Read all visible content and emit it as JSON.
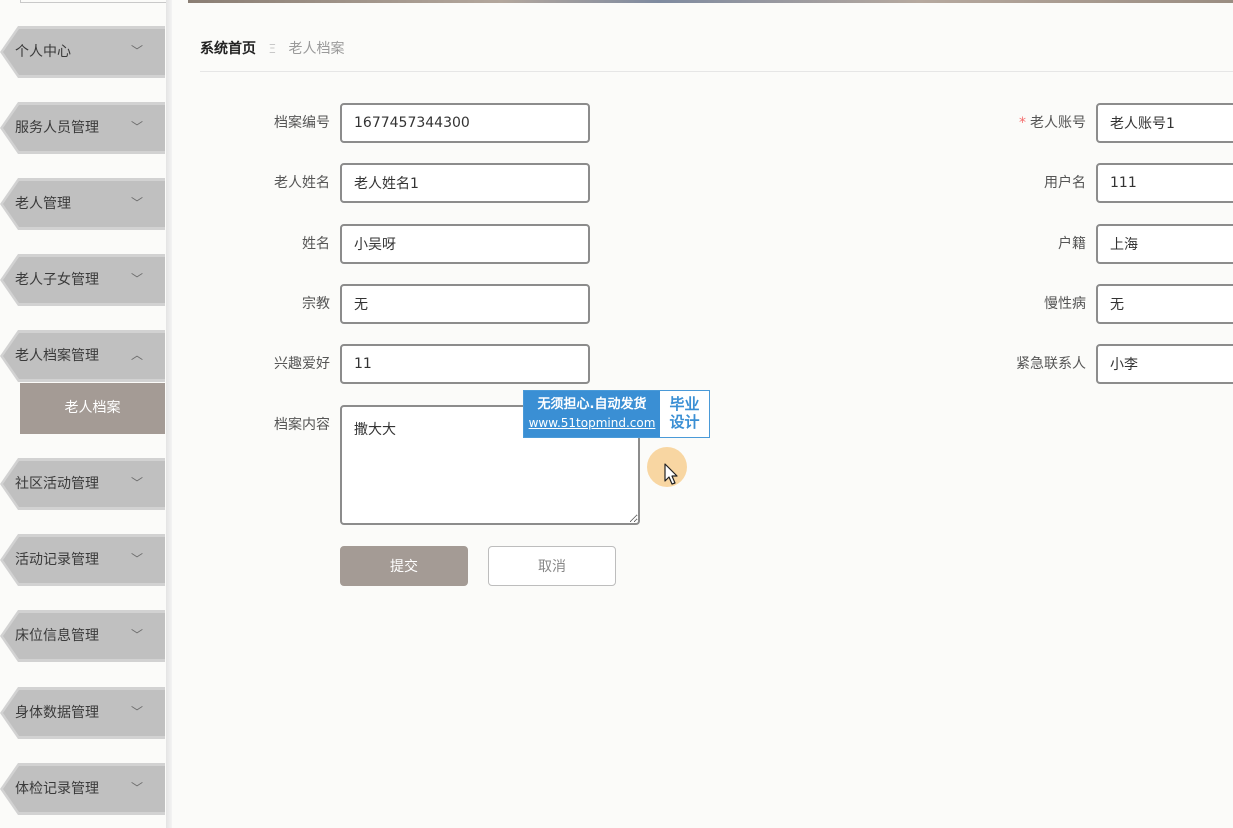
{
  "sidebar": {
    "items": [
      {
        "label": "个人中心",
        "expanded": false
      },
      {
        "label": "服务人员管理",
        "expanded": false
      },
      {
        "label": "老人管理",
        "expanded": false
      },
      {
        "label": "老人子女管理",
        "expanded": false
      },
      {
        "label": "老人档案管理",
        "expanded": true
      },
      {
        "label": "社区活动管理",
        "expanded": false
      },
      {
        "label": "活动记录管理",
        "expanded": false
      },
      {
        "label": "床位信息管理",
        "expanded": false
      },
      {
        "label": "身体数据管理",
        "expanded": false
      },
      {
        "label": "体检记录管理",
        "expanded": false
      }
    ],
    "sub_item": "老人档案",
    "chevron_down": "﹀",
    "chevron_up": "︿"
  },
  "breadcrumb": {
    "home": "系统首页",
    "separator": "Ξ",
    "current": "老人档案"
  },
  "form": {
    "archive_no": {
      "label": "档案编号",
      "value": "1677457344300"
    },
    "elder_account": {
      "label": "老人账号",
      "value": "老人账号1",
      "required_mark": "*"
    },
    "elder_name": {
      "label": "老人姓名",
      "value": "老人姓名1"
    },
    "username": {
      "label": "用户名",
      "value": "111"
    },
    "name": {
      "label": "姓名",
      "value": "小吴呀"
    },
    "household": {
      "label": "户籍",
      "value": "上海"
    },
    "religion": {
      "label": "宗教",
      "value": "无"
    },
    "chronic_disease": {
      "label": "慢性病",
      "value": "无"
    },
    "hobby": {
      "label": "兴趣爱好",
      "value": "11"
    },
    "emergency_contact": {
      "label": "紧急联系人",
      "value": "小李"
    },
    "archive_content": {
      "label": "档案内容",
      "value": "撒大大"
    },
    "submit_label": "提交",
    "cancel_label": "取消"
  },
  "watermark": {
    "line1": "无须担心.自动发货",
    "line2": "www.51topmind.com",
    "right_line1": "毕业",
    "right_line2": "设计"
  },
  "colors": {
    "accent": "#a49b95",
    "menu_bg": "#c0c0c0",
    "required": "#f56c6c",
    "watermark_blue": "#3a8fd4"
  }
}
